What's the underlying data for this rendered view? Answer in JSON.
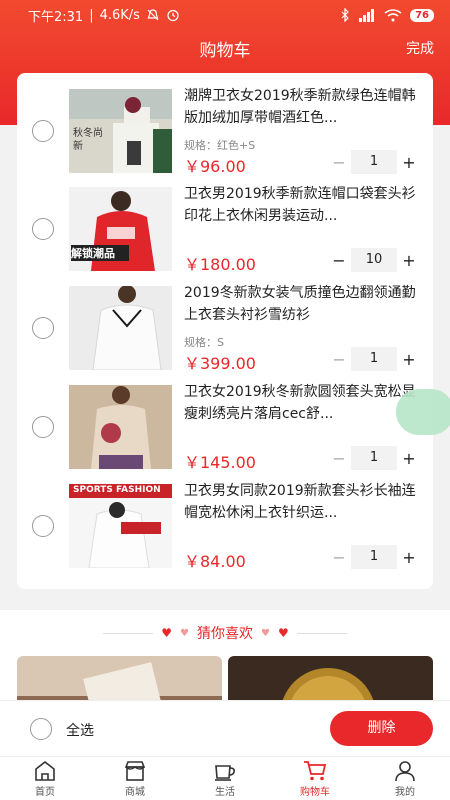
{
  "status_bar": {
    "time": "下午2:31",
    "speed": "4.6K/s",
    "battery": "76"
  },
  "header": {
    "title": "购物车",
    "done_label": "完成"
  },
  "cart_items": [
    {
      "title": "潮牌卫衣女2019秋季新款绿色连帽韩版加绒加厚带帽酒红色...",
      "spec": "规格：红色+S",
      "price": "￥96.00",
      "qty": "1",
      "thumb_text": "秋冬尚新"
    },
    {
      "title": "卫衣男2019秋季新款连帽口袋套头衫印花上衣休闲男装运动...",
      "spec": "",
      "price": "￥180.00",
      "qty": "10",
      "thumb_text": "解锁潮品"
    },
    {
      "title": "2019冬新款女装气质撞色边翻领通勤上衣套头衬衫雪纺衫",
      "spec": "规格：S",
      "price": "￥399.00",
      "qty": "1",
      "thumb_text": ""
    },
    {
      "title": "卫衣女2019秋冬新款圆领套头宽松显瘦刺绣亮片落肩cec舒...",
      "spec": "",
      "price": "￥145.00",
      "qty": "1",
      "thumb_text": ""
    },
    {
      "title": "卫衣男女同款2019新款套头衫长袖连帽宽松休闲上衣针织运...",
      "spec": "",
      "price": "￥84.00",
      "qty": "1",
      "thumb_text": "SPORTS FASHION"
    }
  ],
  "recommendation": {
    "title": "猜你喜欢"
  },
  "action_bar": {
    "select_all_label": "全选",
    "delete_label": "删除"
  },
  "tab_bar": [
    {
      "label": "首页",
      "icon": "home-icon"
    },
    {
      "label": "商城",
      "icon": "store-icon"
    },
    {
      "label": "生活",
      "icon": "cup-icon"
    },
    {
      "label": "购物车",
      "icon": "cart-icon"
    },
    {
      "label": "我的",
      "icon": "user-icon"
    }
  ],
  "colors": {
    "accent": "#e8282a",
    "float_bubble": "#b6e6c9"
  }
}
